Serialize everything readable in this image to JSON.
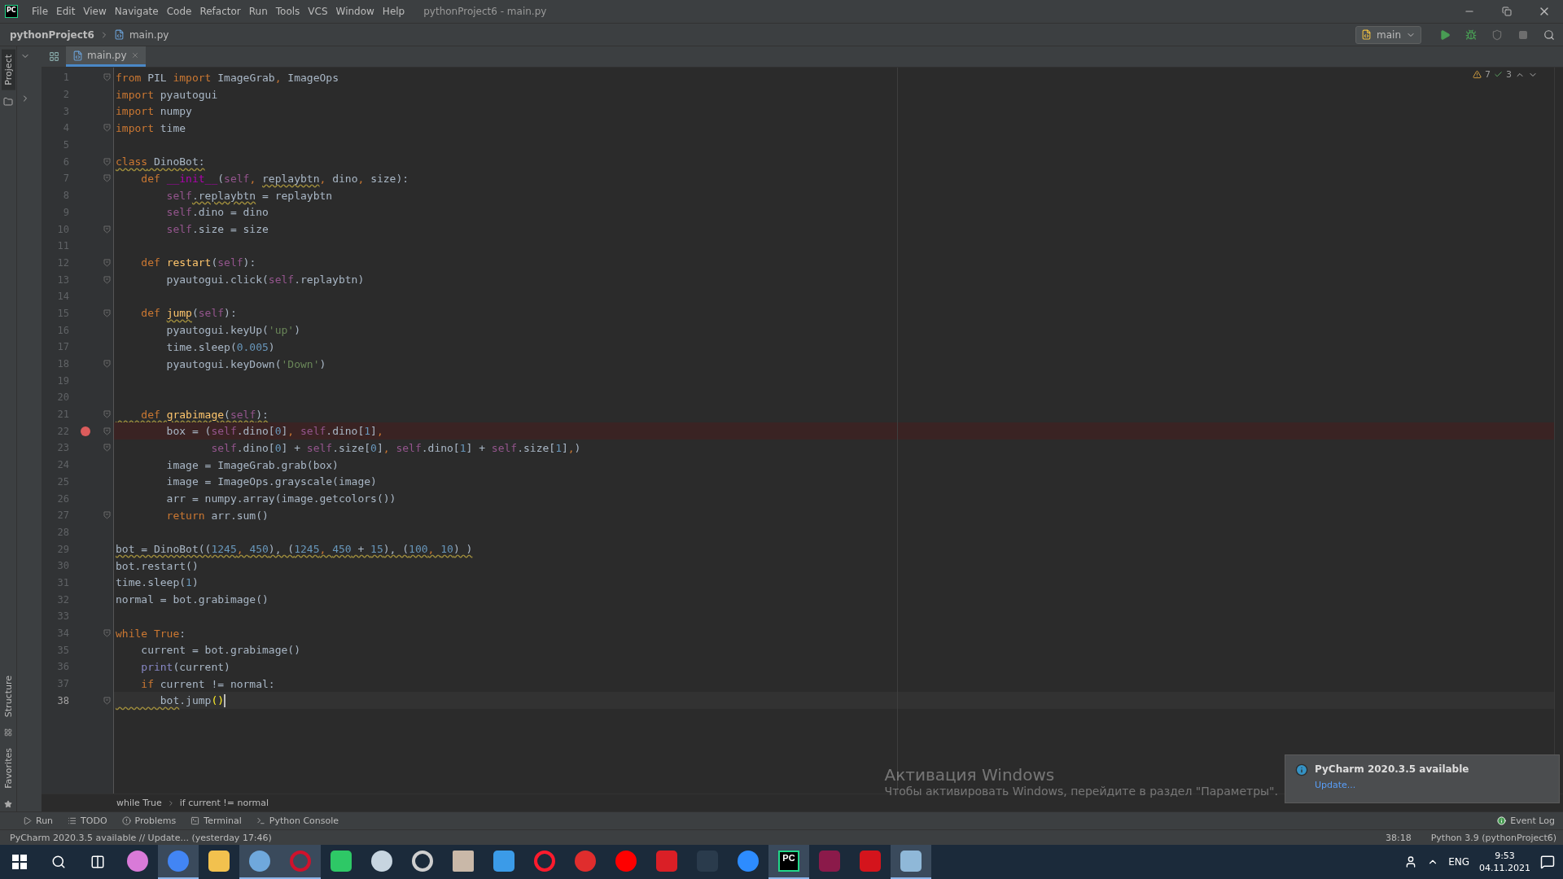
{
  "window": {
    "logo": "PC",
    "menu": [
      "File",
      "Edit",
      "View",
      "Navigate",
      "Code",
      "Refactor",
      "Run",
      "Tools",
      "VCS",
      "Window",
      "Help"
    ],
    "title": "pythonProject6 - main.py"
  },
  "navbar": {
    "project": "pythonProject6",
    "file": "main.py",
    "run_config": "main"
  },
  "tool_strip": {
    "top": [
      {
        "label": "Project",
        "selected": true
      }
    ],
    "bottom": [
      {
        "label": "Structure",
        "selected": false
      },
      {
        "label": "Favorites",
        "selected": false
      }
    ]
  },
  "tabs": [
    {
      "label": "main.py",
      "selected": true
    }
  ],
  "inspections": {
    "warnings": "7",
    "weak_warnings": "3"
  },
  "editor": {
    "lines": [
      {
        "number": "1",
        "fold": true,
        "breakpoint": false,
        "current": false,
        "code": [
          {
            "text": "from",
            "kind": "k"
          },
          {
            "text": " PIL ",
            "kind": "p"
          },
          {
            "text": "import",
            "kind": "k"
          },
          {
            "text": " ImageGrab",
            "kind": "p"
          },
          {
            "text": ",",
            "kind": "k"
          },
          {
            "text": " ImageOps",
            "kind": "p"
          }
        ]
      },
      {
        "number": "2",
        "fold": false,
        "breakpoint": false,
        "current": false,
        "code": [
          {
            "text": "import",
            "kind": "k"
          },
          {
            "text": " pyautogui",
            "kind": "p"
          }
        ]
      },
      {
        "number": "3",
        "fold": false,
        "breakpoint": false,
        "current": false,
        "code": [
          {
            "text": "import",
            "kind": "k"
          },
          {
            "text": " numpy",
            "kind": "p"
          }
        ]
      },
      {
        "number": "4",
        "fold": true,
        "breakpoint": false,
        "current": false,
        "code": [
          {
            "text": "import",
            "kind": "k"
          },
          {
            "text": " time",
            "kind": "p"
          }
        ]
      },
      {
        "number": "5",
        "fold": false,
        "breakpoint": false,
        "current": false
      },
      {
        "number": "6",
        "fold": true,
        "breakpoint": false,
        "current": false,
        "code": [
          {
            "text": "class",
            "kind": "k",
            "warn": true
          },
          {
            "text": " DinoBot:",
            "kind": "p",
            "warn": true
          }
        ]
      },
      {
        "number": "7",
        "fold": true,
        "breakpoint": false,
        "current": false,
        "code": [
          {
            "text": "    def ",
            "kind": "k"
          },
          {
            "text": "__init__",
            "kind": "d"
          },
          {
            "text": "(",
            "kind": "p"
          },
          {
            "text": "self",
            "kind": "s"
          },
          {
            "text": ", ",
            "kind": "k"
          },
          {
            "text": "replaybtn",
            "kind": "p",
            "warn": true
          },
          {
            "text": ", ",
            "kind": "k"
          },
          {
            "text": "dino",
            "kind": "p"
          },
          {
            "text": ", ",
            "kind": "k"
          },
          {
            "text": "size):",
            "kind": "p"
          }
        ]
      },
      {
        "number": "8",
        "fold": false,
        "breakpoint": false,
        "current": false,
        "code": [
          {
            "text": "        self",
            "kind": "s"
          },
          {
            "text": ".replaybtn",
            "kind": "p",
            "warn": true
          },
          {
            "text": " = replaybtn",
            "kind": "p"
          }
        ]
      },
      {
        "number": "9",
        "fold": false,
        "breakpoint": false,
        "current": false,
        "code": [
          {
            "text": "        self",
            "kind": "s"
          },
          {
            "text": ".dino = dino",
            "kind": "p"
          }
        ]
      },
      {
        "number": "10",
        "fold": true,
        "breakpoint": false,
        "current": false,
        "code": [
          {
            "text": "        self",
            "kind": "s"
          },
          {
            "text": ".size = size",
            "kind": "p"
          }
        ]
      },
      {
        "number": "11",
        "fold": false,
        "breakpoint": false,
        "current": false
      },
      {
        "number": "12",
        "fold": true,
        "breakpoint": false,
        "current": false,
        "code": [
          {
            "text": "    def ",
            "kind": "k"
          },
          {
            "text": "restart",
            "kind": "f"
          },
          {
            "text": "(",
            "kind": "p"
          },
          {
            "text": "self",
            "kind": "s"
          },
          {
            "text": "):",
            "kind": "p"
          }
        ]
      },
      {
        "number": "13",
        "fold": true,
        "breakpoint": false,
        "current": false,
        "code": [
          {
            "text": "        pyautogui.click(",
            "kind": "p"
          },
          {
            "text": "self",
            "kind": "s"
          },
          {
            "text": ".replaybtn)",
            "kind": "p"
          }
        ]
      },
      {
        "number": "14",
        "fold": false,
        "breakpoint": false,
        "current": false
      },
      {
        "number": "15",
        "fold": true,
        "breakpoint": false,
        "current": false,
        "code": [
          {
            "text": "    def ",
            "kind": "k"
          },
          {
            "text": "jump",
            "kind": "f",
            "warn": true
          },
          {
            "text": "(",
            "kind": "p"
          },
          {
            "text": "self",
            "kind": "s"
          },
          {
            "text": "):",
            "kind": "p"
          }
        ]
      },
      {
        "number": "16",
        "fold": false,
        "breakpoint": false,
        "current": false,
        "code": [
          {
            "text": "        pyautogui.keyUp(",
            "kind": "p"
          },
          {
            "text": "'up'",
            "kind": "str"
          },
          {
            "text": ")",
            "kind": "p"
          }
        ]
      },
      {
        "number": "17",
        "fold": false,
        "breakpoint": false,
        "current": false,
        "code": [
          {
            "text": "        time.sleep(",
            "kind": "p"
          },
          {
            "text": "0.005",
            "kind": "n"
          },
          {
            "text": ")",
            "kind": "p"
          }
        ]
      },
      {
        "number": "18",
        "fold": true,
        "breakpoint": false,
        "current": false,
        "code": [
          {
            "text": "        pyautogui.keyDown(",
            "kind": "p"
          },
          {
            "text": "'Down'",
            "kind": "str"
          },
          {
            "text": ")",
            "kind": "p"
          }
        ]
      },
      {
        "number": "19",
        "fold": false,
        "breakpoint": false,
        "current": false
      },
      {
        "number": "20",
        "fold": false,
        "breakpoint": false,
        "current": false
      },
      {
        "number": "21",
        "fold": true,
        "breakpoint": false,
        "current": false,
        "code": [
          {
            "text": "    def ",
            "kind": "k",
            "warn": true
          },
          {
            "text": "grabimage",
            "kind": "f",
            "warn": true
          },
          {
            "text": "(",
            "kind": "p",
            "warn": true
          },
          {
            "text": "self",
            "kind": "s",
            "warn": true
          },
          {
            "text": "):",
            "kind": "p",
            "warn": true
          }
        ]
      },
      {
        "number": "22",
        "fold": true,
        "breakpoint": true,
        "current": false,
        "code": [
          {
            "text": "        box = (",
            "kind": "p"
          },
          {
            "text": "self",
            "kind": "s"
          },
          {
            "text": ".dino[",
            "kind": "p"
          },
          {
            "text": "0",
            "kind": "n"
          },
          {
            "text": "]",
            "kind": "p"
          },
          {
            "text": ", ",
            "kind": "k"
          },
          {
            "text": "self",
            "kind": "s"
          },
          {
            "text": ".dino[",
            "kind": "p"
          },
          {
            "text": "1",
            "kind": "n"
          },
          {
            "text": "]",
            "kind": "p"
          },
          {
            "text": ",",
            "kind": "k"
          }
        ]
      },
      {
        "number": "23",
        "fold": true,
        "breakpoint": false,
        "current": false,
        "code": [
          {
            "text": "               self",
            "kind": "s"
          },
          {
            "text": ".dino[",
            "kind": "p"
          },
          {
            "text": "0",
            "kind": "n"
          },
          {
            "text": "] + ",
            "kind": "p"
          },
          {
            "text": "self",
            "kind": "s"
          },
          {
            "text": ".size[",
            "kind": "p"
          },
          {
            "text": "0",
            "kind": "n"
          },
          {
            "text": "]",
            "kind": "p"
          },
          {
            "text": ", ",
            "kind": "k"
          },
          {
            "text": "self",
            "kind": "s"
          },
          {
            "text": ".dino[",
            "kind": "p"
          },
          {
            "text": "1",
            "kind": "n"
          },
          {
            "text": "] + ",
            "kind": "p"
          },
          {
            "text": "self",
            "kind": "s"
          },
          {
            "text": ".size[",
            "kind": "p"
          },
          {
            "text": "1",
            "kind": "n"
          },
          {
            "text": "]",
            "kind": "p"
          },
          {
            "text": ",",
            "kind": "k"
          },
          {
            "text": ")",
            "kind": "p"
          }
        ]
      },
      {
        "number": "24",
        "fold": false,
        "breakpoint": false,
        "current": false,
        "code": [
          {
            "text": "        image = ImageGrab.grab(box)",
            "kind": "p"
          }
        ]
      },
      {
        "number": "25",
        "fold": false,
        "breakpoint": false,
        "current": false,
        "code": [
          {
            "text": "        image = ImageOps.grayscale(image)",
            "kind": "p"
          }
        ]
      },
      {
        "number": "26",
        "fold": false,
        "breakpoint": false,
        "current": false,
        "code": [
          {
            "text": "        arr = numpy.array(image.getcolors())",
            "kind": "p"
          }
        ]
      },
      {
        "number": "27",
        "fold": true,
        "breakpoint": false,
        "current": false,
        "code": [
          {
            "text": "        return",
            "kind": "k"
          },
          {
            "text": " arr.sum()",
            "kind": "p"
          }
        ]
      },
      {
        "number": "28",
        "fold": false,
        "breakpoint": false,
        "current": false
      },
      {
        "number": "29",
        "fold": false,
        "breakpoint": false,
        "current": false,
        "code": [
          {
            "text": "bot = DinoBot((",
            "kind": "p",
            "warn": true
          },
          {
            "text": "1245",
            "kind": "n",
            "warn": true
          },
          {
            "text": ", ",
            "kind": "k",
            "warn": true
          },
          {
            "text": "450",
            "kind": "n",
            "warn": true
          },
          {
            "text": "), (",
            "kind": "p",
            "warn": true
          },
          {
            "text": "1245",
            "kind": "n",
            "warn": true
          },
          {
            "text": ", ",
            "kind": "k",
            "warn": true
          },
          {
            "text": "450",
            "kind": "n",
            "warn": true
          },
          {
            "text": " + ",
            "kind": "p",
            "warn": true
          },
          {
            "text": "15",
            "kind": "n",
            "warn": true
          },
          {
            "text": "), (",
            "kind": "p",
            "warn": true
          },
          {
            "text": "100",
            "kind": "n",
            "warn": true
          },
          {
            "text": ", ",
            "kind": "k",
            "warn": true
          },
          {
            "text": "10",
            "kind": "n",
            "warn": true
          },
          {
            "text": ") )",
            "kind": "p",
            "warn": true
          }
        ]
      },
      {
        "number": "30",
        "fold": false,
        "breakpoint": false,
        "current": false,
        "code": [
          {
            "text": "bot.restart()",
            "kind": "p"
          }
        ]
      },
      {
        "number": "31",
        "fold": false,
        "breakpoint": false,
        "current": false,
        "code": [
          {
            "text": "time.sleep(",
            "kind": "p"
          },
          {
            "text": "1",
            "kind": "n"
          },
          {
            "text": ")",
            "kind": "p"
          }
        ]
      },
      {
        "number": "32",
        "fold": false,
        "breakpoint": false,
        "current": false,
        "code": [
          {
            "text": "normal = bot.grabimage()",
            "kind": "p"
          }
        ]
      },
      {
        "number": "33",
        "fold": false,
        "breakpoint": false,
        "current": false
      },
      {
        "number": "34",
        "fold": true,
        "breakpoint": false,
        "current": false,
        "code": [
          {
            "text": "while True",
            "kind": "k"
          },
          {
            "text": ":",
            "kind": "p"
          }
        ]
      },
      {
        "number": "35",
        "fold": false,
        "breakpoint": false,
        "current": false,
        "code": [
          {
            "text": "    current = bot.grabimage()",
            "kind": "p"
          }
        ]
      },
      {
        "number": "36",
        "fold": false,
        "breakpoint": false,
        "current": false,
        "code": [
          {
            "text": "    print",
            "kind": "b"
          },
          {
            "text": "(current)",
            "kind": "p"
          }
        ]
      },
      {
        "number": "37",
        "fold": false,
        "breakpoint": false,
        "current": false,
        "code": [
          {
            "text": "    if",
            "kind": "k"
          },
          {
            "text": " current != normal:",
            "kind": "p"
          }
        ]
      },
      {
        "number": "38",
        "fold": true,
        "breakpoint": false,
        "current": true,
        "code": [
          {
            "text": "       bot",
            "kind": "p",
            "warn": true
          },
          {
            "text": ".jump",
            "kind": "p"
          },
          {
            "text": "()",
            "kind": "m"
          }
        ]
      }
    ]
  },
  "breadcrumbs": [
    "while True",
    "if current != normal"
  ],
  "activation": {
    "title": "Активация Windows",
    "text": "Чтобы активировать Windows, перейдите в раздел \"Параметры\"."
  },
  "notification": {
    "title": "PyCharm 2020.3.5 available",
    "link": "Update..."
  },
  "tool_windows": [
    "Run",
    "TODO",
    "Problems",
    "Terminal",
    "Python Console"
  ],
  "event_log": "Event Log",
  "status_bar": {
    "message": "PyCharm 2020.3.5 available // Update... (yesterday 17:46)",
    "position": "38:18",
    "interpreter": "Python 3.9 (pythonProject6)"
  },
  "taskbar": {
    "apps": [
      {
        "kind": "circle",
        "color": "#d97ad8",
        "active": false
      },
      {
        "kind": "circle",
        "color": "#4285f4",
        "active": true
      },
      {
        "kind": "square",
        "color": "#f2c14e",
        "active": false
      },
      {
        "kind": "circle",
        "color": "#6fa8dc",
        "active": true
      },
      {
        "kind": "ring",
        "color": "#d0122c",
        "active": true
      },
      {
        "kind": "square",
        "color": "#2ec866",
        "active": false
      },
      {
        "kind": "circle",
        "color": "#c7d5e0",
        "active": false
      },
      {
        "kind": "ring",
        "color": "#cfcfcf",
        "active": false
      },
      {
        "kind": "photo",
        "color": "#c9b8a8",
        "active": false
      },
      {
        "kind": "square",
        "color": "#3b9be8",
        "active": false
      },
      {
        "kind": "ring",
        "color": "#ff1b2d",
        "active": false
      },
      {
        "kind": "circle",
        "color": "#e02d2d",
        "active": false
      },
      {
        "kind": "circle",
        "color": "#ff0000",
        "active": false
      },
      {
        "kind": "square",
        "color": "#da1f26",
        "active": false
      },
      {
        "kind": "square",
        "color": "#2a3b4c",
        "active": false
      },
      {
        "kind": "circle",
        "color": "#2d8cff",
        "active": false
      },
      {
        "kind": "logo",
        "color": "#000000",
        "active": true,
        "label": "PC"
      },
      {
        "kind": "square",
        "color": "#8b1a4a",
        "active": false
      },
      {
        "kind": "square",
        "color": "#d4141c",
        "active": false
      },
      {
        "kind": "square",
        "color": "#8fb8d8",
        "active": true
      }
    ],
    "language": "ENG",
    "time": "9:53",
    "date": "04.11.2021"
  }
}
